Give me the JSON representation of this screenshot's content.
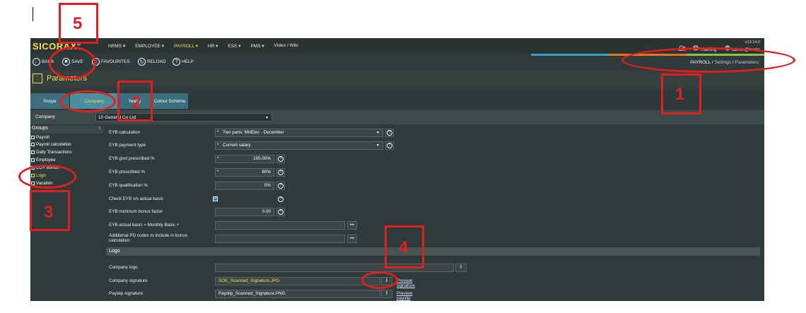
{
  "app": {
    "logo": "SICORAX",
    "logo_mark": "®",
    "version": "v13.14.0",
    "nav": [
      {
        "label": "HRMS ▾",
        "active": false
      },
      {
        "label": "EMPLOYEE ▾",
        "active": false
      },
      {
        "label": "PAYROLL ▾",
        "active": true
      },
      {
        "label": "HR ▾",
        "active": false
      },
      {
        "label": "ESS ▾",
        "active": false
      },
      {
        "label": "PMS ▾",
        "active": false
      },
      {
        "label": "Video / Wiki",
        "active": false
      }
    ],
    "notification_count": "6",
    "environment": "Training",
    "user": "admin@bunic",
    "stripe_colors": [
      "#2aa7c9",
      "#e8751a",
      "#8bc34a"
    ]
  },
  "toolbar": {
    "back": "BACK",
    "save": "SAVE",
    "favourites": "FAVOURITES",
    "reload": "RELOAD",
    "help": "HELP"
  },
  "breadcrumb": {
    "root": "PAYROLL",
    "sep": "/",
    "mid": "Settings",
    "leaf": "Parameters"
  },
  "page": {
    "title": "Parameters"
  },
  "tabs": [
    {
      "label": "Scope",
      "active": false
    },
    {
      "label": "Company",
      "active": true
    },
    {
      "label": "Yearly",
      "active": false
    },
    {
      "label": "Colour Scheme",
      "active": false
    }
  ],
  "company": {
    "label": "Company",
    "value": "10 General Co Ltd"
  },
  "groups": {
    "heading": "Groups",
    "items": [
      {
        "label": "Payroll",
        "active": false
      },
      {
        "label": "Payroll calculation",
        "active": false
      },
      {
        "label": "Daily Transactions",
        "active": false
      },
      {
        "label": "Employee",
        "active": false
      },
      {
        "label": "EOY Bonus",
        "active": false
      },
      {
        "label": "Logo",
        "active": true
      },
      {
        "label": "Vacation",
        "active": false
      }
    ]
  },
  "fields": {
    "eyb_calc": {
      "label": "EYB calculation",
      "value": "Two parts: MidDec - December"
    },
    "eyb_pay": {
      "label": "EYB payment type",
      "value": "Current salary"
    },
    "eyb_govt": {
      "label": "EYB govt prescribed %",
      "value": "100.00%"
    },
    "eyb_pres": {
      "label": "EYB prescribed %",
      "value": "80%"
    },
    "eyb_qual": {
      "label": "EYB qualification %",
      "value": "0%"
    },
    "check_eyb": {
      "label": "Check EYB v/s actual basic",
      "checked": true
    },
    "eyb_min": {
      "label": "EYB minimum bonus factor",
      "value": "0.00"
    },
    "eyb_actual": {
      "label": "EYB actual basic = Monthly Basic +",
      "value": ""
    },
    "add_pd": {
      "label": "Additional PD codes to include in bonus calculation",
      "value": ""
    }
  },
  "logo_section": {
    "title": "Logo",
    "company_logo": {
      "label": "Company logo",
      "value": ""
    },
    "company_signature": {
      "label": "Company signature",
      "value": "SOE_Scanned_Signature.JPG",
      "link": "Preview signature"
    },
    "payslip_signature": {
      "label": "Payslip signature",
      "value": "Payslip_Scanned_Signature.PNG",
      "link": "Preview payslip signature"
    }
  },
  "annotations": {
    "n1": "1",
    "n2": "2",
    "n3": "3",
    "n4": "4",
    "n5": "5"
  },
  "symbols": {
    "req": "*",
    "arrow": "▼",
    "q": "?",
    "dots": "•••",
    "upload": "⭱",
    "check": "✓",
    "chev": "‹"
  }
}
